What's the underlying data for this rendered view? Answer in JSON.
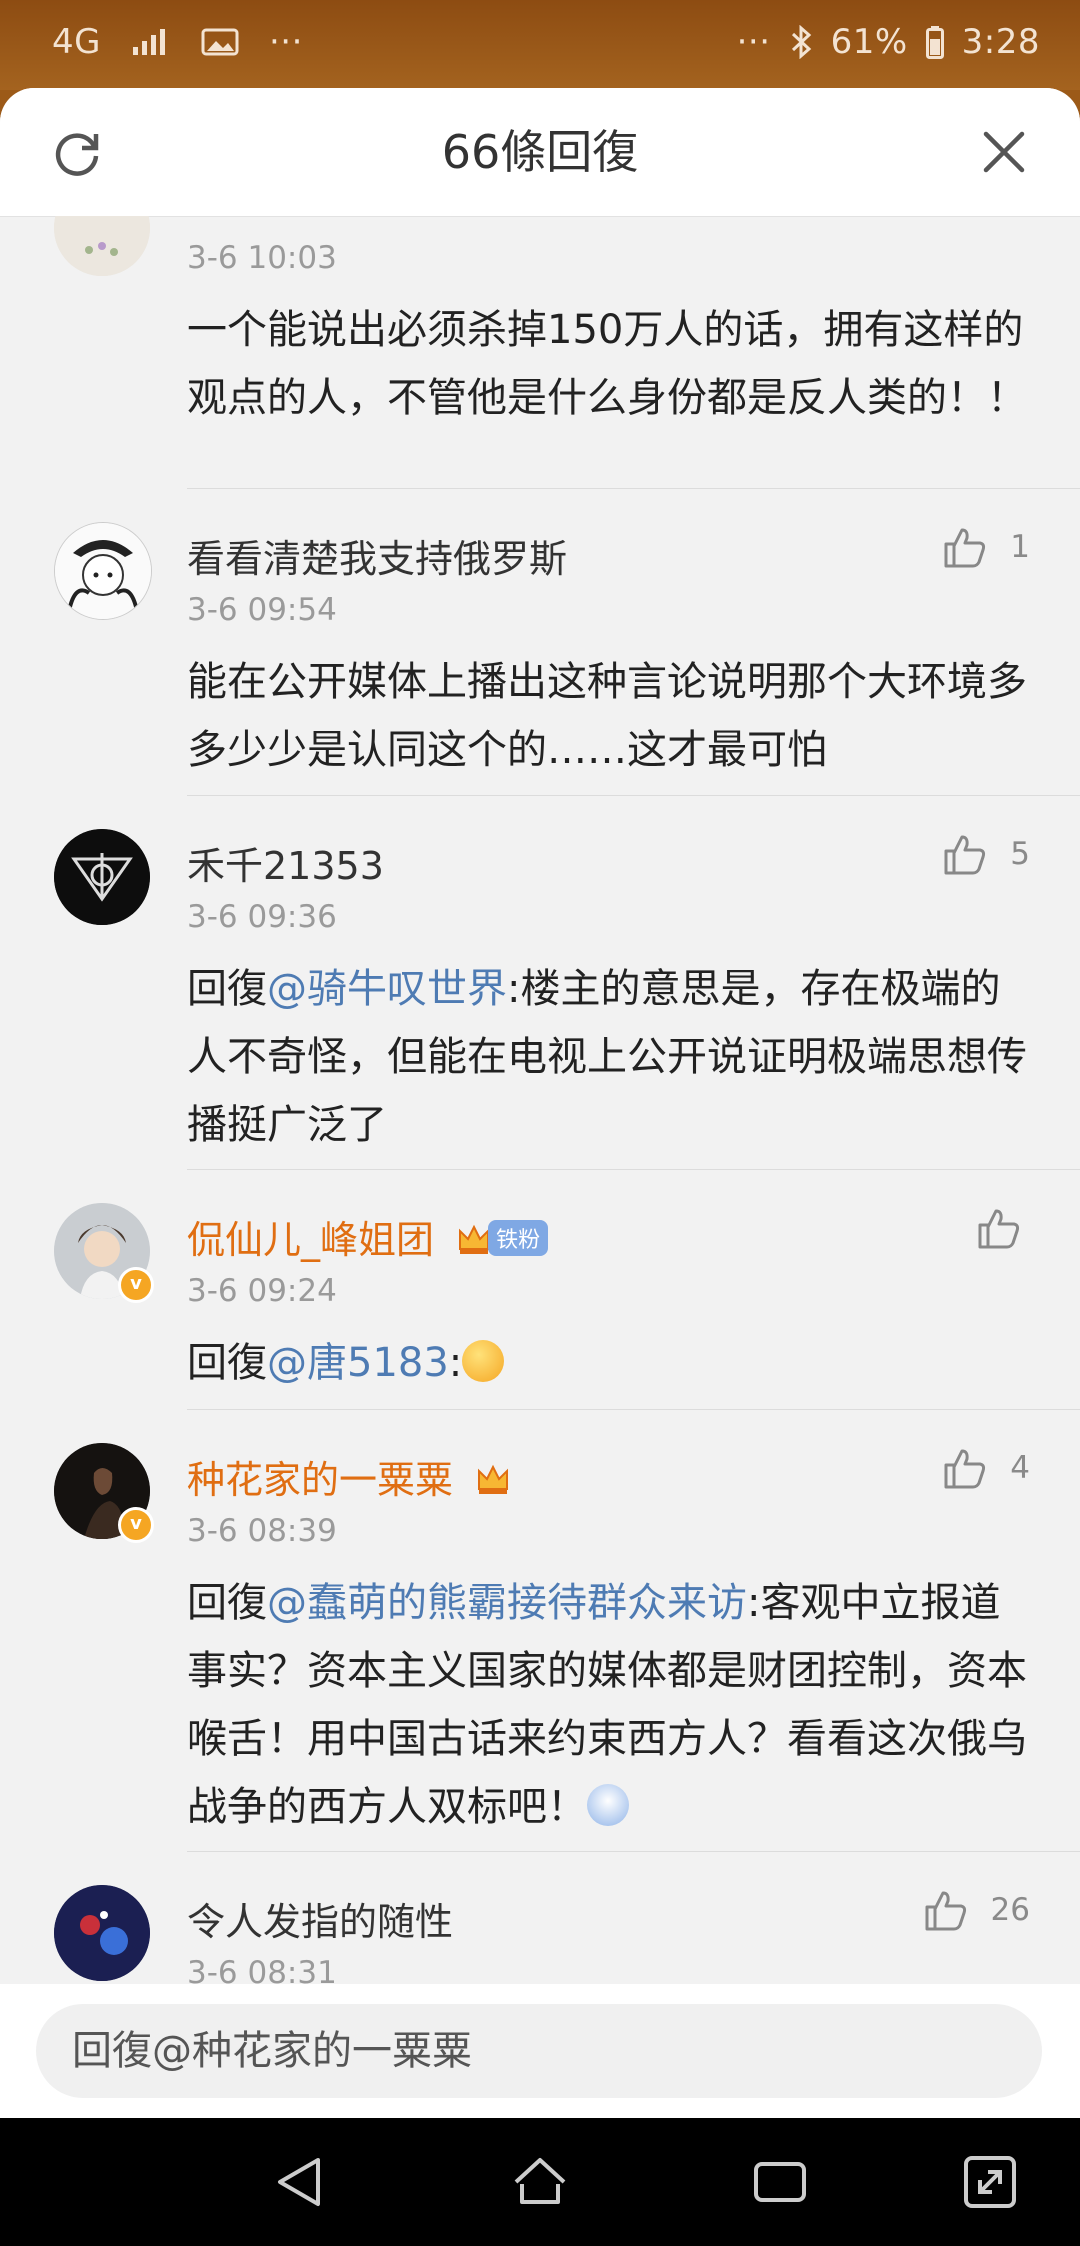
{
  "status_bar": {
    "network": "4G",
    "battery": "61%",
    "time": "3:28",
    "overflow_left": "···",
    "overflow_right": "···"
  },
  "header": {
    "title": "66條回復"
  },
  "comments": [
    {
      "name": "",
      "time": "3-6 10:03",
      "body": "一个能说出必须杀掉150万人的话，拥有这样的观点的人，不管他是什么身份都是反人类的！！",
      "likes": ""
    },
    {
      "name": "看看清楚我支持俄罗斯",
      "time": "3-6 09:54",
      "body": "能在公开媒体上播出这种言论说明那个大环境多多少少是认同这个的……这才最可怕",
      "likes": "1"
    },
    {
      "name": "禾千21353",
      "time": "3-6 09:36",
      "prefix": "回復",
      "mention": "@骑牛叹世界",
      "body": ":楼主的意思是，存在极端的人不奇怪，但能在电视上公开说证明极端思想传播挺广泛了",
      "likes": "5"
    },
    {
      "name": "侃仙儿_峰姐团",
      "fan_badge": "铁粉",
      "time": "3-6 09:24",
      "prefix": "回復",
      "mention": "@唐5183",
      "body": ":",
      "likes": ""
    },
    {
      "name": "种花家的一粟粟",
      "time": "3-6 08:39",
      "prefix": "回復",
      "mention": "@蠢萌的熊霸接待群众来访",
      "body": ":客观中立报道事实？资本主义国家的媒体都是财团控制，资本喉舌！用中国古话来约束西方人？看看这次俄乌战争的西方人双标吧！",
      "likes": "4"
    },
    {
      "name": "令人发指的随性",
      "time": "3-6 08:31",
      "body": "",
      "likes": "26"
    }
  ],
  "input": {
    "placeholder": "回復@种花家的一粟粟"
  },
  "colors": {
    "mention": "#4e7bb3",
    "vip_name": "#e06e12",
    "sheet_bg": "#f2f2f2"
  }
}
